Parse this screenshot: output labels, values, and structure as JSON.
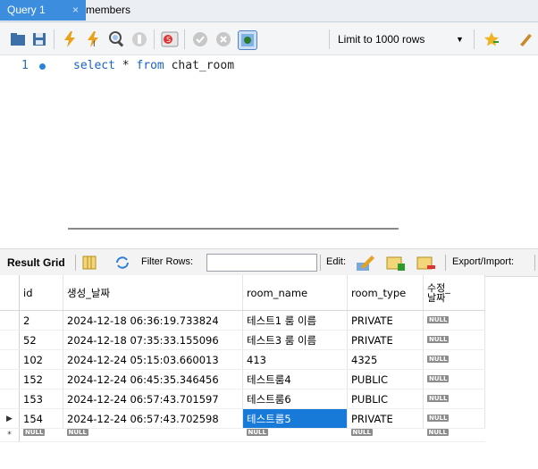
{
  "tabs": [
    {
      "label": "Query 1",
      "close": "×"
    },
    {
      "label": "members"
    }
  ],
  "toolbar": {
    "limit_label": "Limit to 1000 rows",
    "icons": [
      "open-folder-icon",
      "save-icon",
      "execute-icon",
      "execute-line-icon",
      "explain-icon",
      "stop-icon",
      "toggle-autocommit-icon",
      "commit-icon",
      "rollback-icon",
      "toggle-beautify-icon",
      "limit-dropdown-icon",
      "star-icon",
      "brush-icon"
    ]
  },
  "editor": {
    "line_number": "1",
    "code": {
      "kw1": "select",
      "mid1": " * ",
      "kw2": "from",
      "tail": " chat_room"
    }
  },
  "result": {
    "result_grid_label": "Result Grid",
    "filter_label": "Filter Rows:",
    "filter_value": "",
    "edit_label": "Edit:",
    "export_label": "Export/Import:",
    "columns": [
      "id",
      "생성_날짜",
      "room_name",
      "room_type",
      "수정_\n날짜"
    ],
    "rows": [
      {
        "id": "2",
        "date": "2024-12-18 06:36:19.733824",
        "name": "테스트1 룸 이름",
        "type": "PRIVATE",
        "mod": "NULL"
      },
      {
        "id": "52",
        "date": "2024-12-18 07:35:33.155096",
        "name": "테스트3 룸 이름",
        "type": "PRIVATE",
        "mod": "NULL"
      },
      {
        "id": "102",
        "date": "2024-12-24 05:15:03.660013",
        "name": "413",
        "type": "4325",
        "mod": "NULL"
      },
      {
        "id": "152",
        "date": "2024-12-24 06:45:35.346456",
        "name": "테스트룸4",
        "type": "PUBLIC",
        "mod": "NULL"
      },
      {
        "id": "153",
        "date": "2024-12-24 06:57:43.701597",
        "name": "테스트룸6",
        "type": "PUBLIC",
        "mod": "NULL"
      },
      {
        "id": "154",
        "date": "2024-12-24 06:57:43.702598",
        "name": "테스트룸5",
        "type": "PRIVATE",
        "mod": "NULL"
      }
    ],
    "new_row": {
      "id": "NULL",
      "date": "NULL",
      "name": "NULL",
      "type": "NULL",
      "mod": "NULL"
    },
    "current_row_marker": "▶",
    "new_row_marker": "*"
  }
}
